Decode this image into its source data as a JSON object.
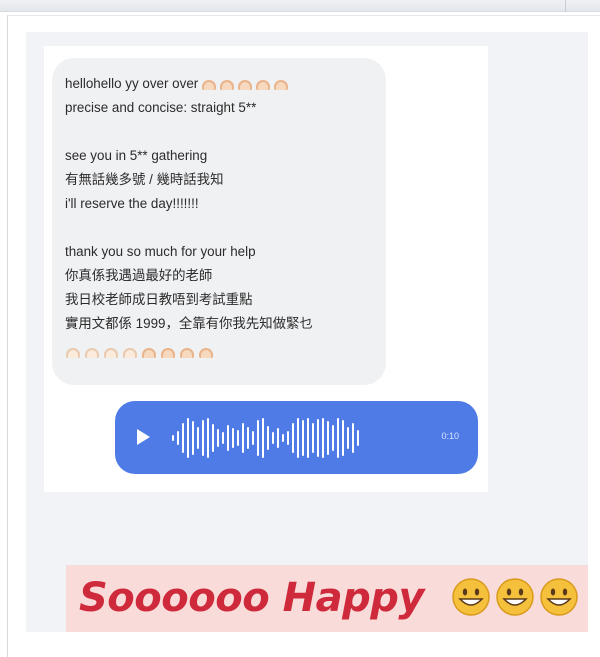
{
  "message": {
    "lines": [
      "hellohello yy over over",
      "precise and concise: straight 5**",
      "",
      "see you in 5** gathering",
      "有無話幾多號 / 幾時話我知",
      "i'll reserve the day!!!!!!!",
      "",
      "thank you so much for your help",
      "你真係我遇過最好的老師",
      "我日校老師成日教唔到考試重點",
      "實用文都係 1999，全靠有你我先知做緊乜"
    ],
    "emoji_icon": "raised-hands-icon"
  },
  "voice_message": {
    "play_icon": "play-icon",
    "duration": "0:10"
  },
  "banner": {
    "caption": "Soooooo Happy",
    "emoji_icon": "grinning-face-icon",
    "emoji_count": 3
  },
  "colors": {
    "voice_bubble": "#4f7be6",
    "banner_background": "#f9dcd9",
    "banner_text": "#cf2a3c"
  }
}
